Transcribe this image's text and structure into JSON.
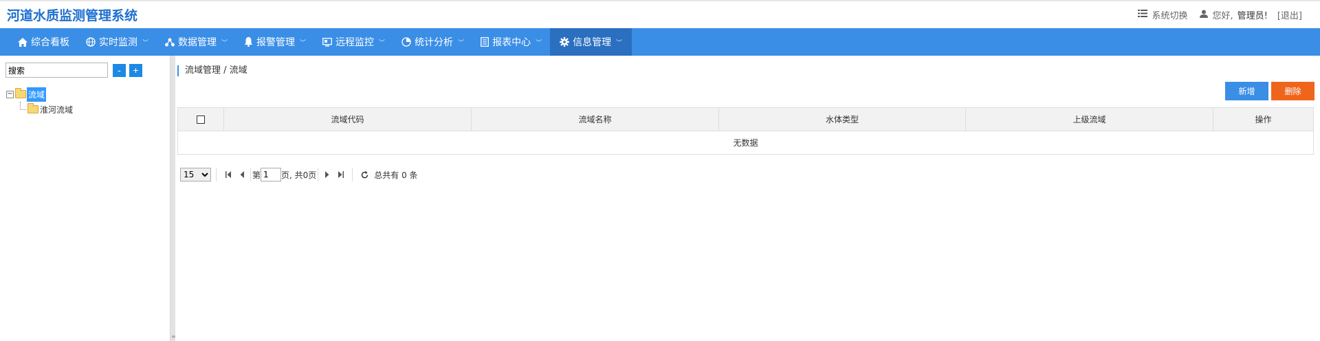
{
  "app": {
    "title": "河道水质监测管理系统"
  },
  "header": {
    "system_switch": "系统切换",
    "greeting": "您好,",
    "user": "管理员!",
    "logout": "[退出]"
  },
  "nav": {
    "items": [
      {
        "label": "综合看板",
        "icon": "home-icon",
        "dropdown": false
      },
      {
        "label": "实时监测",
        "icon": "globe-icon",
        "dropdown": true
      },
      {
        "label": "数据管理",
        "icon": "network-icon",
        "dropdown": true
      },
      {
        "label": "报警管理",
        "icon": "bell-icon",
        "dropdown": true
      },
      {
        "label": "远程监控",
        "icon": "monitor-icon",
        "dropdown": true
      },
      {
        "label": "统计分析",
        "icon": "pie-chart-icon",
        "dropdown": true
      },
      {
        "label": "报表中心",
        "icon": "report-icon",
        "dropdown": true
      },
      {
        "label": "信息管理",
        "icon": "gear-icon",
        "dropdown": true,
        "active": true
      }
    ]
  },
  "sidebar": {
    "search_placeholder": "搜索",
    "collapse_label": "-",
    "expand_label": "+",
    "tree": {
      "root_toggle": "−",
      "root": "流域",
      "children": [
        "淮河流域"
      ]
    }
  },
  "main": {
    "breadcrumb": "流域管理 / 流域",
    "add_label": "新增",
    "delete_label": "删除",
    "table": {
      "columns": [
        "流域代码",
        "流域名称",
        "水体类型",
        "上级流域",
        "操作"
      ],
      "empty_text": "无数据"
    },
    "pager": {
      "page_size": "15",
      "page_prefix": "第",
      "page_value": "1",
      "page_suffix": "页, 共0页",
      "total": "总共有 0 条"
    }
  },
  "colors": {
    "nav_bg": "#3a8ee6",
    "nav_active": "#2a6fc0",
    "title": "#1e6fd0",
    "add": "#3a8ee6",
    "delete": "#f0651c"
  }
}
